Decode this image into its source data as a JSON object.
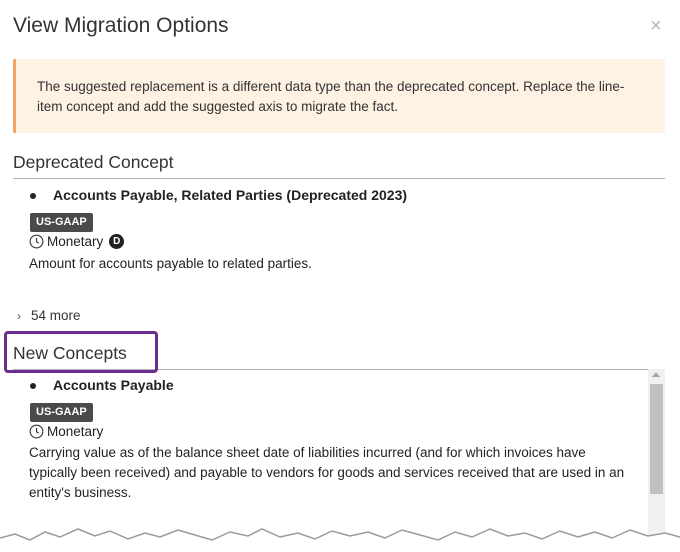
{
  "dialog": {
    "title": "View Migration Options",
    "close_glyph": "×"
  },
  "warning": {
    "text": "The suggested replacement is a different data type than the deprecated concept. Replace the line-item concept and add the suggested axis to migrate the fact."
  },
  "deprecated": {
    "heading": "Deprecated Concept",
    "concept": {
      "name": "Accounts Payable, Related Parties (Deprecated 2023)",
      "badge": "US-GAAP",
      "type": "Monetary",
      "balance_badge": "D",
      "description": "Amount for accounts payable to related parties."
    },
    "more_label": "54 more"
  },
  "new_concepts": {
    "heading": "New Concepts",
    "concept": {
      "name": "Accounts Payable",
      "badge": "US-GAAP",
      "type": "Monetary",
      "description_lines": [
        "Carrying value as of the balance sheet date of liabilities incurred (and for which invoices have",
        "typically been received) and payable to vendors for goods and services received that are used in an",
        "entity's business."
      ]
    }
  },
  "colors": {
    "warning_bg": "#fdf2e3",
    "warning_border": "#f0a56a",
    "highlight": "#6b2d8f",
    "badge_bg": "#4a4a4a"
  },
  "icons": [
    "close-icon",
    "clock-icon",
    "chevron-right-icon",
    "debit-badge-icon",
    "scroll-up-icon"
  ]
}
